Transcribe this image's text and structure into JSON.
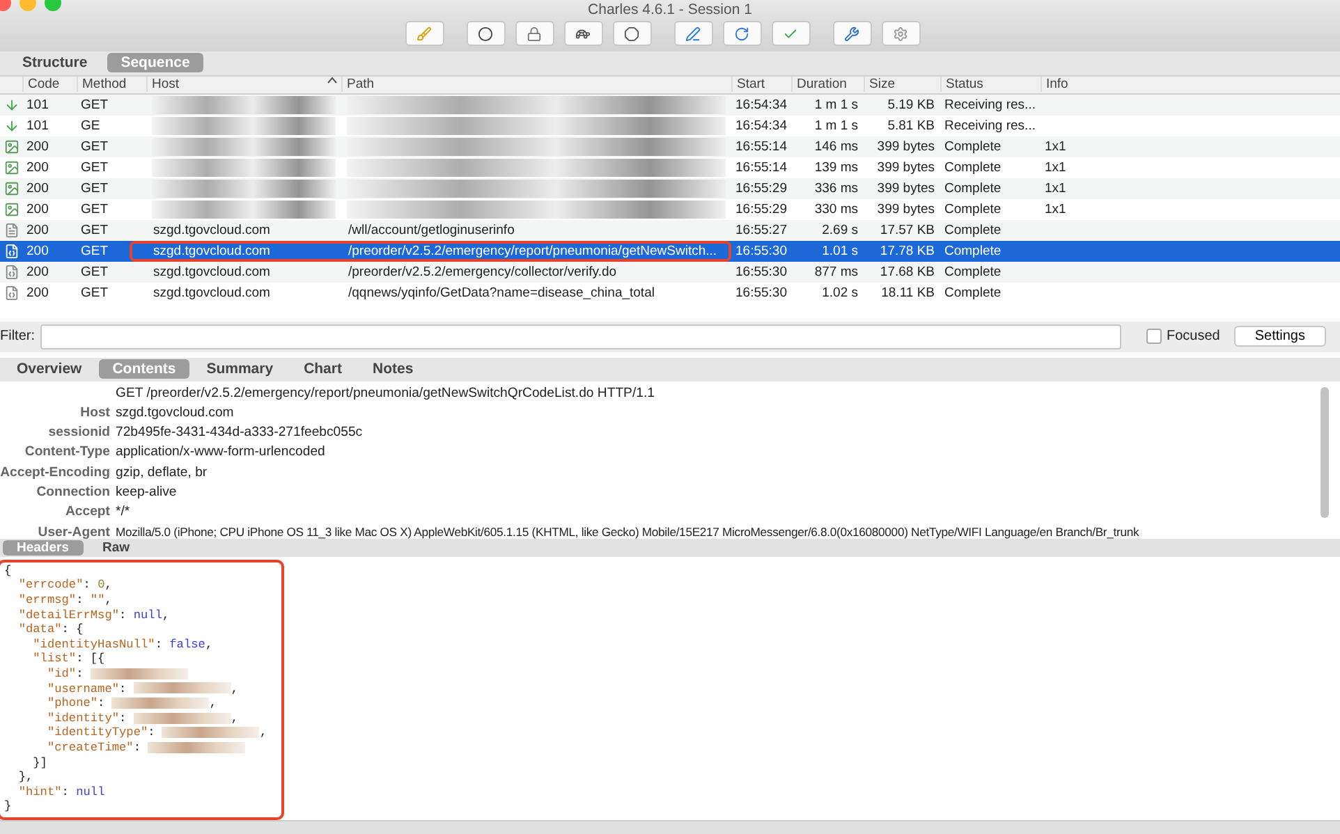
{
  "window": {
    "title": "Charles 4.6.1 - Session 1"
  },
  "toolbar": {
    "buttons": [
      {
        "kind": "broom"
      },
      {
        "kind": "record"
      },
      {
        "kind": "lock"
      },
      {
        "kind": "turtle"
      },
      {
        "kind": "stop"
      },
      {
        "kind": "pen"
      },
      {
        "kind": "refresh"
      },
      {
        "kind": "check"
      },
      {
        "kind": "tools"
      },
      {
        "kind": "gear"
      }
    ]
  },
  "view_tabs": [
    {
      "label": "Structure",
      "selected": false
    },
    {
      "label": "Sequence",
      "selected": true
    }
  ],
  "table": {
    "columns": [
      "Code",
      "Method",
      "Host",
      "Path",
      "Start",
      "Duration",
      "Size",
      "Status",
      "Info"
    ],
    "rows": [
      {
        "kind": "download",
        "code": "101",
        "method": "GET",
        "redacted": true,
        "start": "16:54:34",
        "duration": "1 m 1 s",
        "size": "5.19 KB",
        "status": "Receiving res...",
        "selected": false
      },
      {
        "kind": "download",
        "code": "101",
        "method": "GE",
        "redacted": true,
        "start": "16:54:34",
        "duration": "1 m 1 s",
        "size": "5.81 KB",
        "status": "Receiving res...",
        "selected": false
      },
      {
        "kind": "image",
        "code": "200",
        "method": "GET",
        "redacted": true,
        "start": "16:55:14",
        "duration": "146 ms",
        "size": "399 bytes",
        "status": "Complete",
        "info": "1x1",
        "selected": false
      },
      {
        "kind": "image",
        "code": "200",
        "method": "GET",
        "redacted": true,
        "start": "16:55:14",
        "duration": "139 ms",
        "size": "399 bytes",
        "status": "Complete",
        "info": "1x1",
        "selected": false
      },
      {
        "kind": "image",
        "code": "200",
        "method": "GET",
        "redacted": true,
        "start": "16:55:29",
        "duration": "336 ms",
        "size": "399 bytes",
        "status": "Complete",
        "info": "1x1",
        "selected": false
      },
      {
        "kind": "image",
        "code": "200",
        "method": "GET",
        "redacted": true,
        "start": "16:55:29",
        "duration": "330 ms",
        "size": "399 bytes",
        "status": "Complete",
        "info": "1x1",
        "selected": false
      },
      {
        "kind": "text",
        "code": "200",
        "method": "GET",
        "host": "szgd.tgovcloud.com",
        "path": "/wll/account/getloginuserinfo",
        "annotated": false,
        "start": "16:55:27",
        "duration": "2.69 s",
        "size": "17.57 KB",
        "status": "Complete",
        "selected": false
      },
      {
        "kind": "json",
        "code": "200",
        "method": "GET",
        "host": "szgd.tgovcloud.com",
        "path": "/preorder/v2.5.2/emergency/report/pneumonia/getNewSwitch...",
        "annotated": true,
        "start": "16:55:30",
        "duration": "1.01 s",
        "size": "17.78 KB",
        "status": "Complete",
        "selected": true
      },
      {
        "kind": "json",
        "code": "200",
        "method": "GET",
        "host": "szgd.tgovcloud.com",
        "path": "/preorder/v2.5.2/emergency/collector/verify.do",
        "annotated": false,
        "start": "16:55:30",
        "duration": "877 ms",
        "size": "17.68 KB",
        "status": "Complete",
        "selected": false
      },
      {
        "kind": "json",
        "code": "200",
        "method": "GET",
        "host": "szgd.tgovcloud.com",
        "path": "/qqnews/yqinfo/GetData?name=disease_china_total",
        "annotated": false,
        "start": "16:55:30",
        "duration": "1.02 s",
        "size": "18.11 KB",
        "status": "Complete",
        "selected": false
      }
    ]
  },
  "filter": {
    "label": "Filter:",
    "focused": {
      "label": "Focused",
      "checked": false
    },
    "settings_button": "Settings"
  },
  "detail_tabs": [
    {
      "label": "Overview",
      "selected": false
    },
    {
      "label": "Contents",
      "selected": true
    },
    {
      "label": "Summary",
      "selected": false
    },
    {
      "label": "Chart",
      "selected": false
    },
    {
      "label": "Notes",
      "selected": false
    }
  ],
  "request": {
    "request_line": "GET /preorder/v2.5.2/emergency/report/pneumonia/getNewSwitchQrCodeList.do HTTP/1.1",
    "headers": [
      {
        "name": "Host",
        "value": "szgd.tgovcloud.com"
      },
      {
        "name": "sessionid",
        "value": "72b495fe-3431-434d-a333-271feebc055c"
      },
      {
        "name": "Content-Type",
        "value": "application/x-www-form-urlencoded"
      },
      {
        "name": "Accept-Encoding",
        "value": "gzip, deflate, br"
      },
      {
        "name": "Connection",
        "value": "keep-alive"
      },
      {
        "name": "Accept",
        "value": "*/*"
      },
      {
        "name": "User-Agent",
        "value": "Mozilla/5.0 (iPhone; CPU iPhone OS 11_3 like Mac OS X) AppleWebKit/605.1.15 (KHTML, like Gecko) Mobile/15E217 MicroMessenger/6.8.0(0x16080000) NetType/WIFI Language/en Branch/Br_trunk"
      }
    ]
  },
  "response_tabs": [
    {
      "label": "Headers",
      "selected": true
    },
    {
      "label": "Raw",
      "selected": false
    }
  ],
  "response_body": [
    {
      "parts": [
        {
          "kind": "punct",
          "text": "{"
        }
      ]
    },
    {
      "parts": [
        {
          "kind": "key",
          "text": "  \"errcode\""
        },
        {
          "kind": "punct",
          "text": ": "
        },
        {
          "kind": "number",
          "text": "0"
        },
        {
          "kind": "punct",
          "text": ","
        }
      ]
    },
    {
      "parts": [
        {
          "kind": "key",
          "text": "  \"errmsg\""
        },
        {
          "kind": "punct",
          "text": ": "
        },
        {
          "kind": "string",
          "text": "\"\""
        },
        {
          "kind": "punct",
          "text": ","
        }
      ]
    },
    {
      "parts": [
        {
          "kind": "key",
          "text": "  \"detailErrMsg\""
        },
        {
          "kind": "punct",
          "text": ": "
        },
        {
          "kind": "keyword",
          "text": "null"
        },
        {
          "kind": "punct",
          "text": ","
        }
      ]
    },
    {
      "parts": [
        {
          "kind": "key",
          "text": "  \"data\""
        },
        {
          "kind": "punct",
          "text": ": {"
        }
      ]
    },
    {
      "parts": [
        {
          "kind": "key",
          "text": "    \"identityHasNull\""
        },
        {
          "kind": "punct",
          "text": ": "
        },
        {
          "kind": "keyword",
          "text": "false"
        },
        {
          "kind": "punct",
          "text": ","
        }
      ]
    },
    {
      "parts": [
        {
          "kind": "key",
          "text": "    \"list\""
        },
        {
          "kind": "punct",
          "text": ": [{"
        }
      ]
    },
    {
      "parts": [
        {
          "kind": "key",
          "text": "      \"id\""
        },
        {
          "kind": "punct",
          "text": ": "
        },
        {
          "kind": "redacted"
        }
      ]
    },
    {
      "parts": [
        {
          "kind": "key",
          "text": "      \"username\""
        },
        {
          "kind": "punct",
          "text": ": "
        },
        {
          "kind": "redacted"
        },
        {
          "kind": "punct",
          "text": ","
        }
      ]
    },
    {
      "parts": [
        {
          "kind": "key",
          "text": "      \"phone\""
        },
        {
          "kind": "punct",
          "text": ": "
        },
        {
          "kind": "redacted"
        },
        {
          "kind": "punct",
          "text": ","
        }
      ]
    },
    {
      "parts": [
        {
          "kind": "key",
          "text": "      \"identity\""
        },
        {
          "kind": "punct",
          "text": ": "
        },
        {
          "kind": "redacted"
        },
        {
          "kind": "punct",
          "text": ","
        }
      ]
    },
    {
      "parts": [
        {
          "kind": "key",
          "text": "      \"identityType\""
        },
        {
          "kind": "punct",
          "text": ": "
        },
        {
          "kind": "redacted"
        },
        {
          "kind": "punct",
          "text": ","
        }
      ]
    },
    {
      "parts": [
        {
          "kind": "key",
          "text": "      \"createTime\""
        },
        {
          "kind": "punct",
          "text": ": "
        },
        {
          "kind": "redacted"
        }
      ]
    },
    {
      "parts": [
        {
          "kind": "punct",
          "text": "    }]"
        }
      ]
    },
    {
      "parts": [
        {
          "kind": "punct",
          "text": "  },"
        }
      ]
    },
    {
      "parts": [
        {
          "kind": "key",
          "text": "  \"hint\""
        },
        {
          "kind": "punct",
          "text": ": "
        },
        {
          "kind": "keyword",
          "text": "null"
        }
      ]
    },
    {
      "parts": [
        {
          "kind": "punct",
          "text": "}"
        }
      ]
    }
  ]
}
